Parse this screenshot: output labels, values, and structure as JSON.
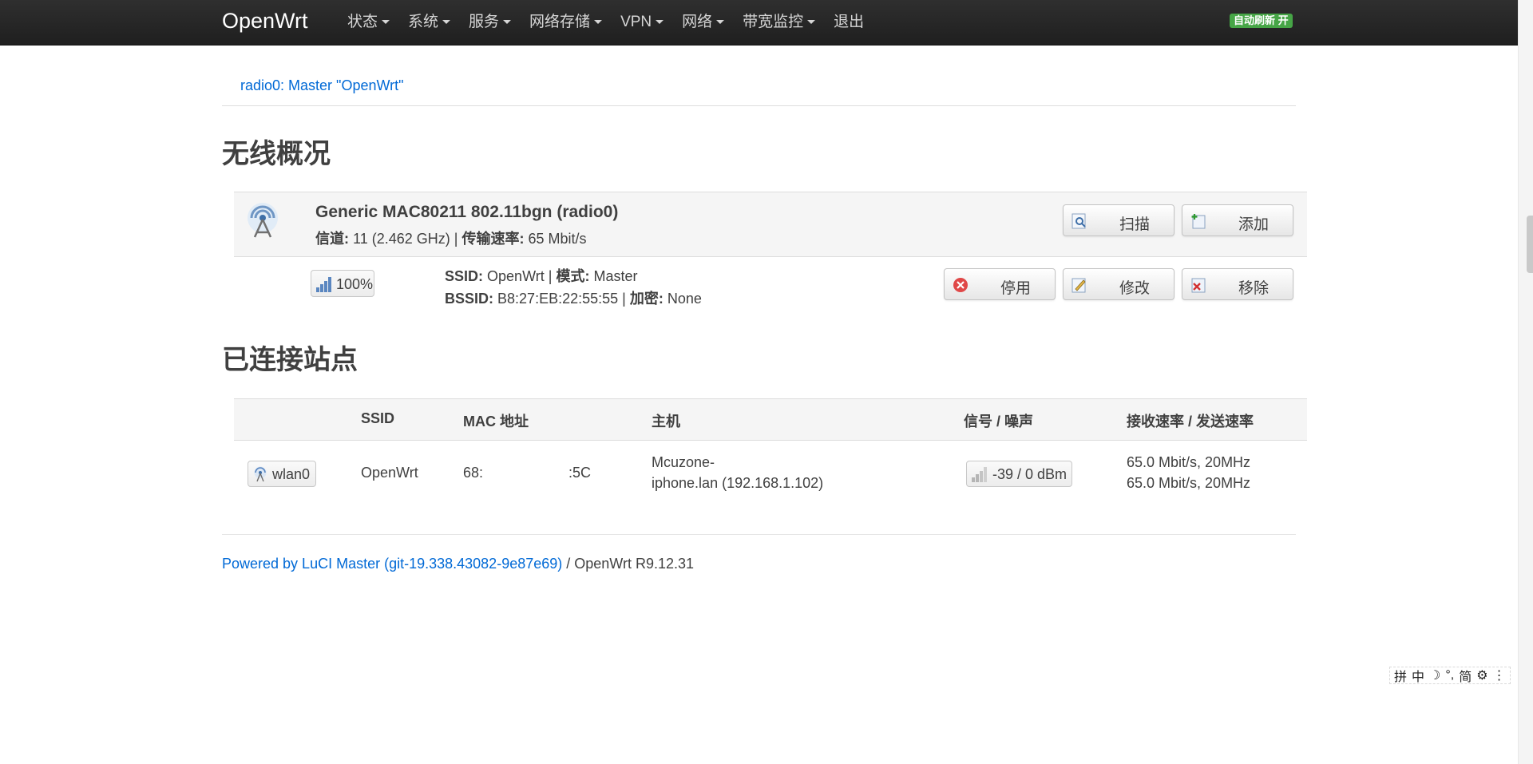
{
  "navbar": {
    "brand": "OpenWrt",
    "menu": [
      {
        "label": "状态",
        "has_caret": true
      },
      {
        "label": "系统",
        "has_caret": true
      },
      {
        "label": "服务",
        "has_caret": true
      },
      {
        "label": "网络存储",
        "has_caret": true
      },
      {
        "label": "VPN",
        "has_caret": true
      },
      {
        "label": "网络",
        "has_caret": true
      },
      {
        "label": "带宽监控",
        "has_caret": true
      },
      {
        "label": "退出",
        "has_caret": false
      }
    ],
    "autorefresh": "自动刷新 开",
    "autorefresh_color": "#46a546"
  },
  "breadcrumb": {
    "tab": "radio0: Master \"OpenWrt\""
  },
  "overview": {
    "heading": "无线概况",
    "radio": {
      "name": "Generic MAC80211 802.11bgn (radio0)",
      "channel_label": "信道:",
      "channel_value": "11 (2.462 GHz)",
      "separator": "|",
      "bitrate_label": "传输速率:",
      "bitrate_value": "65 Mbit/s",
      "scan_button": "扫描",
      "add_button": "添加"
    },
    "network": {
      "signal_percent": "100%",
      "ssid_label": "SSID:",
      "ssid_value": "OpenWrt",
      "mode_label": "模式:",
      "mode_value": "Master",
      "bssid_label": "BSSID:",
      "bssid_value": "B8:27:EB:22:55:55",
      "encryption_label": "加密:",
      "encryption_value": "None",
      "separator": "|",
      "disable_button": "停用",
      "edit_button": "修改",
      "remove_button": "移除"
    }
  },
  "stations": {
    "heading": "已连接站点",
    "columns": [
      "SSID",
      "MAC 地址",
      "主机",
      "信号 / 噪声",
      "接收速率 / 发送速率"
    ],
    "rows": [
      {
        "iface": "wlan0",
        "ssid": "OpenWrt",
        "mac_prefix": "68:",
        "mac_suffix": ":5C",
        "host_line1": "Mcuzone-",
        "host_line2": "iphone.lan (192.168.1.102)",
        "signal_noise": "-39 / 0 dBm",
        "rx_rate": "65.0 Mbit/s, 20MHz",
        "tx_rate": "65.0 Mbit/s, 20MHz"
      }
    ]
  },
  "footer": {
    "link_text": "Powered by LuCI Master (git-19.338.43082-9e87e69)",
    "suffix": " / OpenWrt R9.12.31",
    "link_color": "#0069d6"
  },
  "ime_toolbar": {
    "items": [
      "拼",
      "中",
      "☽",
      "°,",
      "简",
      "⚙",
      "⋮"
    ]
  }
}
